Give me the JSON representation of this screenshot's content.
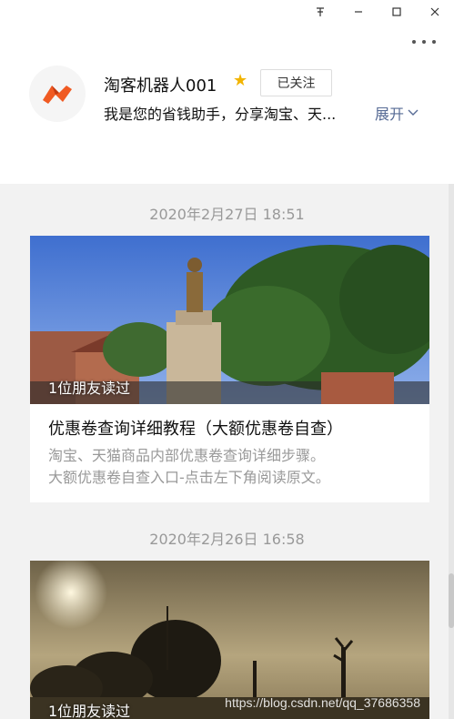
{
  "window_controls": {
    "pin": "𝍖",
    "minimize": "—",
    "maximize": "☐",
    "close": "✕"
  },
  "account": {
    "name": "淘客机器人001",
    "star": "★",
    "follow_label": "已关注",
    "description": "我是您的省钱助手，分享淘宝、天...",
    "expand_label": "展开"
  },
  "articles": [
    {
      "date": "2020年2月27日 18:51",
      "read_by": "1位朋友读过",
      "title": "优惠卷查询详细教程（大额优惠卷自查）",
      "summary_line1": "淘宝、天猫商品内部优惠卷查询详细步骤。",
      "summary_line2": "大额优惠卷自查入口-点击左下角阅读原文。"
    },
    {
      "date": "2020年2月26日 16:58",
      "read_by": "1位朋友读过"
    }
  ],
  "watermark": "https://blog.csdn.net/qq_37686358",
  "colors": {
    "link": "#576b95",
    "star": "#f2b400",
    "muted": "#999999"
  }
}
